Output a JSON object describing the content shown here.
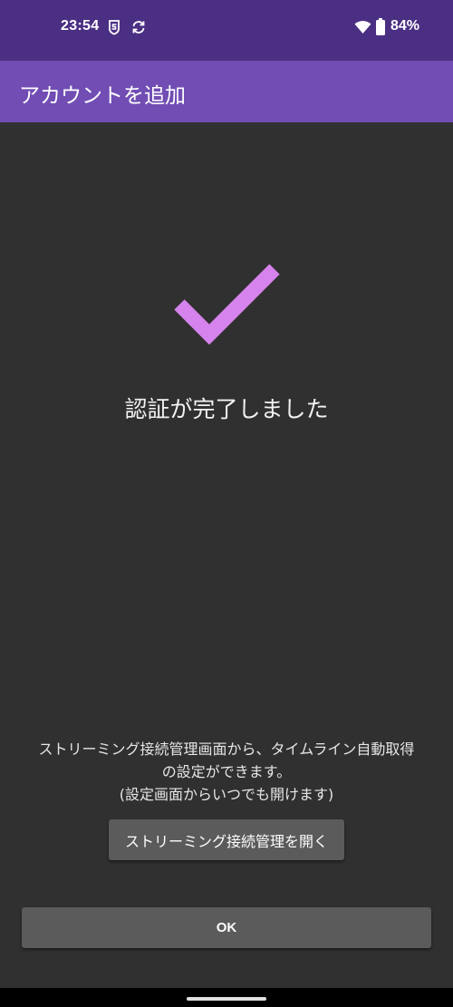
{
  "status_bar": {
    "time": "23:54",
    "battery_percent": "84%",
    "icons": [
      "sim-shield-icon",
      "sync-icon",
      "wifi-icon",
      "battery-icon"
    ]
  },
  "app_bar": {
    "title": "アカウントを追加"
  },
  "main": {
    "icon": "check-icon",
    "success_title": "認証が完了しました",
    "info_line_1": "ストリーミング接続管理画面から、タイムライン自動取得",
    "info_line_2": "の設定ができます。",
    "info_line_3": "(設定画面からいつでも開けます)",
    "open_button_label": "ストリーミング接続管理を開く",
    "ok_button_label": "OK"
  },
  "colors": {
    "status_bar": "#4b2f83",
    "app_bar": "#714db4",
    "background": "#303030",
    "check_mark": "#d683ed",
    "button": "#5b5b5b"
  }
}
